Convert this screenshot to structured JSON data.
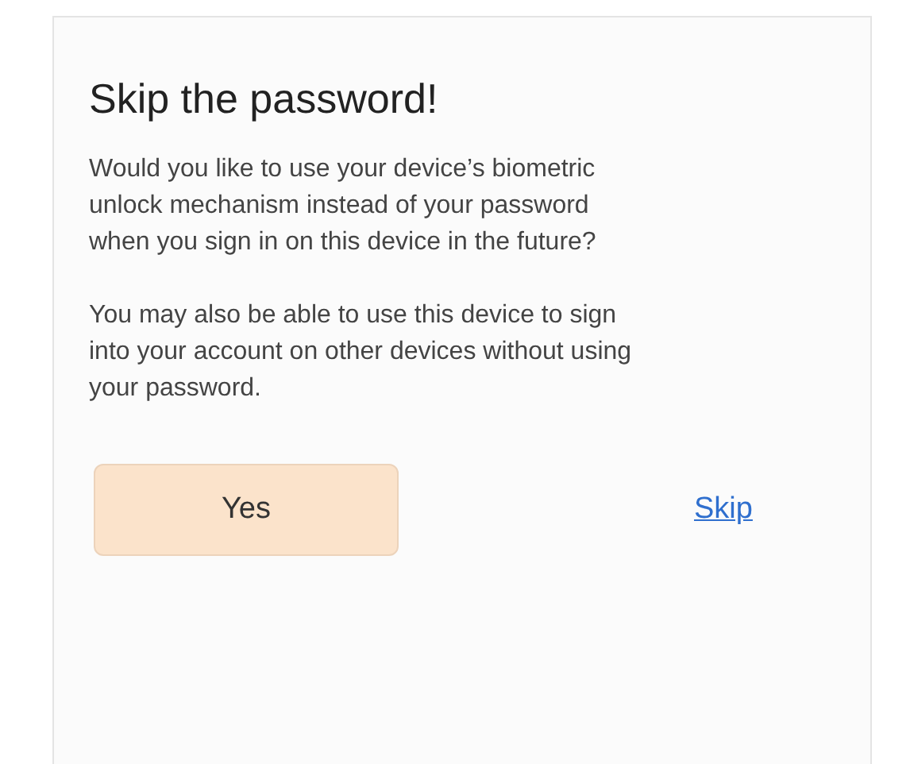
{
  "dialog": {
    "title": "Skip the password!",
    "paragraphs": [
      "Would you like to use your device’s biometric unlock mechanism instead of your password when you sign in on this device in the future?",
      "You may also be able to use this device to sign into your account on other devices without using your password."
    ],
    "primary_button": "Yes",
    "secondary_link": "Skip"
  }
}
